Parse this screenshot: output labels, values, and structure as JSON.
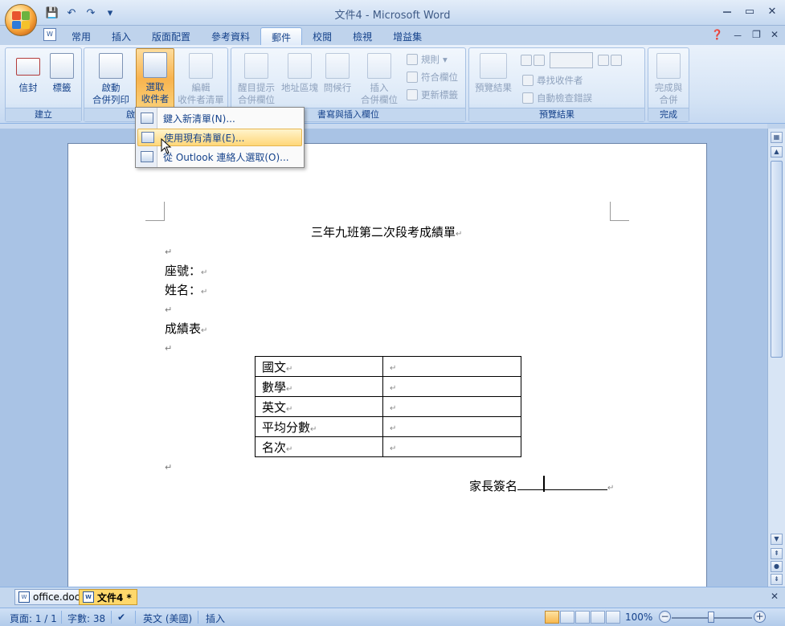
{
  "window": {
    "title": "文件4 - Microsoft Word",
    "controls": [
      "－",
      "▭",
      "✕"
    ]
  },
  "qat": [
    "💾",
    "↶",
    "↷"
  ],
  "tabs": [
    {
      "label": "常用"
    },
    {
      "label": "插入"
    },
    {
      "label": "版面配置"
    },
    {
      "label": "參考資料"
    },
    {
      "label": "郵件",
      "active": true
    },
    {
      "label": "校閱"
    },
    {
      "label": "檢視"
    },
    {
      "label": "增益集"
    }
  ],
  "ribbon": {
    "create": {
      "label": "建立",
      "envelopes": "信封",
      "labels": "標籤"
    },
    "start_merge": {
      "label": "啟",
      "start_merge_line1": "啟動",
      "start_merge_line2": "合併列印",
      "select_recipients_line1": "選取",
      "select_recipients_line2": "收件者",
      "edit_list_line1": "編輯",
      "edit_list_line2": "收件者清單"
    },
    "write_insert": {
      "label": "書寫與插入欄位",
      "highlight_line1": "醒目提示",
      "highlight_line2": "合併欄位",
      "address_block": "地址區塊",
      "greeting_line": "問候行",
      "insert_field_line1": "插入",
      "insert_field_line2": "合併欄位",
      "rules": "規則",
      "match_fields": "符合欄位",
      "update_labels": "更新標籤"
    },
    "preview": {
      "label": "預覽結果",
      "preview_results": "預覽結果",
      "find_recipient": "尋找收件者",
      "auto_check": "自動檢查錯誤"
    },
    "finish": {
      "label": "完成",
      "finish_merge_line1": "完成與",
      "finish_merge_line2": "合併"
    }
  },
  "menu": {
    "items": [
      {
        "label": "鍵入新清單(N)..."
      },
      {
        "label": "使用現有清單(E)..."
      },
      {
        "label": "從 Outlook 連絡人選取(O)..."
      }
    ]
  },
  "document": {
    "title": "三年九班第二次段考成績單",
    "seat_label": "座號：",
    "name_label": "姓名：",
    "grades_label": "成績表",
    "signature_label": "家長簽名",
    "table": [
      {
        "subject": "國文",
        "value": ""
      },
      {
        "subject": "數學",
        "value": ""
      },
      {
        "subject": "英文",
        "value": ""
      },
      {
        "subject": "平均分數",
        "value": ""
      },
      {
        "subject": "名次",
        "value": ""
      }
    ]
  },
  "doc_tabs": [
    {
      "label": "office.doc"
    },
    {
      "label": "文件4 *",
      "active": true
    }
  ],
  "status": {
    "page": "頁面: 1 / 1",
    "words": "字數: 38",
    "language": "英文 (美國)",
    "mode": "插入",
    "zoom": "100%"
  },
  "colors": {
    "accent": "#15428b",
    "ribbon_bg": "#d4e3f5",
    "hover": "#ffd779"
  }
}
